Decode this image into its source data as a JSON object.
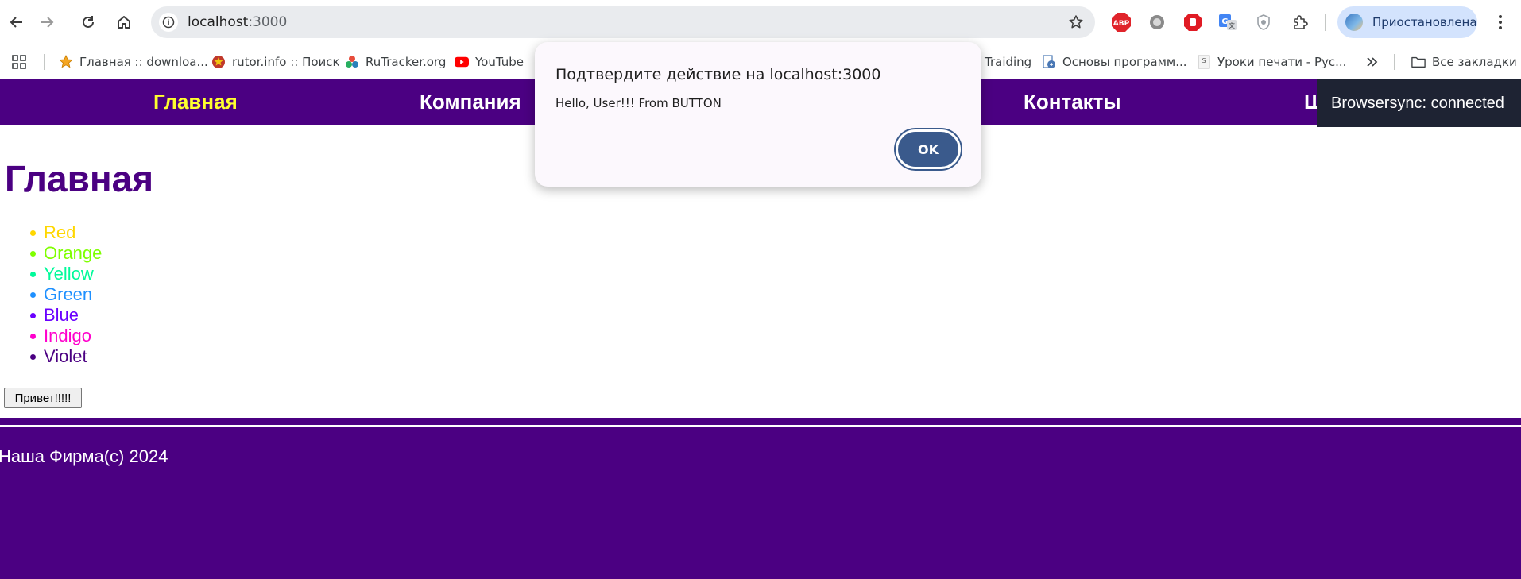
{
  "browser": {
    "url_host": "localhost",
    "url_port": ":3000",
    "profile_status": "Приостановлена",
    "extensions": [
      "adblock-plus-icon",
      "circle-extension-icon",
      "stop-hand-icon",
      "google-translate-icon",
      "shield-extension-icon",
      "puzzle-icon"
    ],
    "bookmarks": [
      {
        "label": "Главная :: downloa...",
        "icon": "star-icon"
      },
      {
        "label": "rutor.info :: Поиск",
        "icon": "rutor-icon"
      },
      {
        "label": "RuTracker.org",
        "icon": "rutracker-icon"
      },
      {
        "label": "YouTube",
        "icon": "youtube-icon"
      },
      {
        "label": "Traiding",
        "icon": ""
      },
      {
        "label": "Основы программ...",
        "icon": "document-icon"
      },
      {
        "label": "Уроки печати - Рус...",
        "icon": "s-icon"
      }
    ],
    "all_bookmarks_label": "Все закладки"
  },
  "site": {
    "nav": [
      "Главная",
      "Компания",
      "Контакты",
      "Ш"
    ],
    "heading": "Главная",
    "colors": [
      {
        "label": "Red",
        "color": "#ffd700"
      },
      {
        "label": "Orange",
        "color": "#7fff00"
      },
      {
        "label": "Yellow",
        "color": "#00fa9a"
      },
      {
        "label": "Green",
        "color": "#1e90ff"
      },
      {
        "label": "Blue",
        "color": "#6a00ff"
      },
      {
        "label": "Indigo",
        "color": "#ff00cc"
      },
      {
        "label": "Violet",
        "color": "#4b0082"
      }
    ],
    "button_label": "Привет!!!!!",
    "footer": "Наша Фирма(с) 2024",
    "brand_color": "#4b0082",
    "active_nav_color": "#ffff2e"
  },
  "dialog": {
    "title": "Подтвердите действие на localhost:3000",
    "message": "Hello, User!!! From BUTTON",
    "ok_label": "OK"
  },
  "toast": {
    "text": "Browsersync: connected"
  }
}
